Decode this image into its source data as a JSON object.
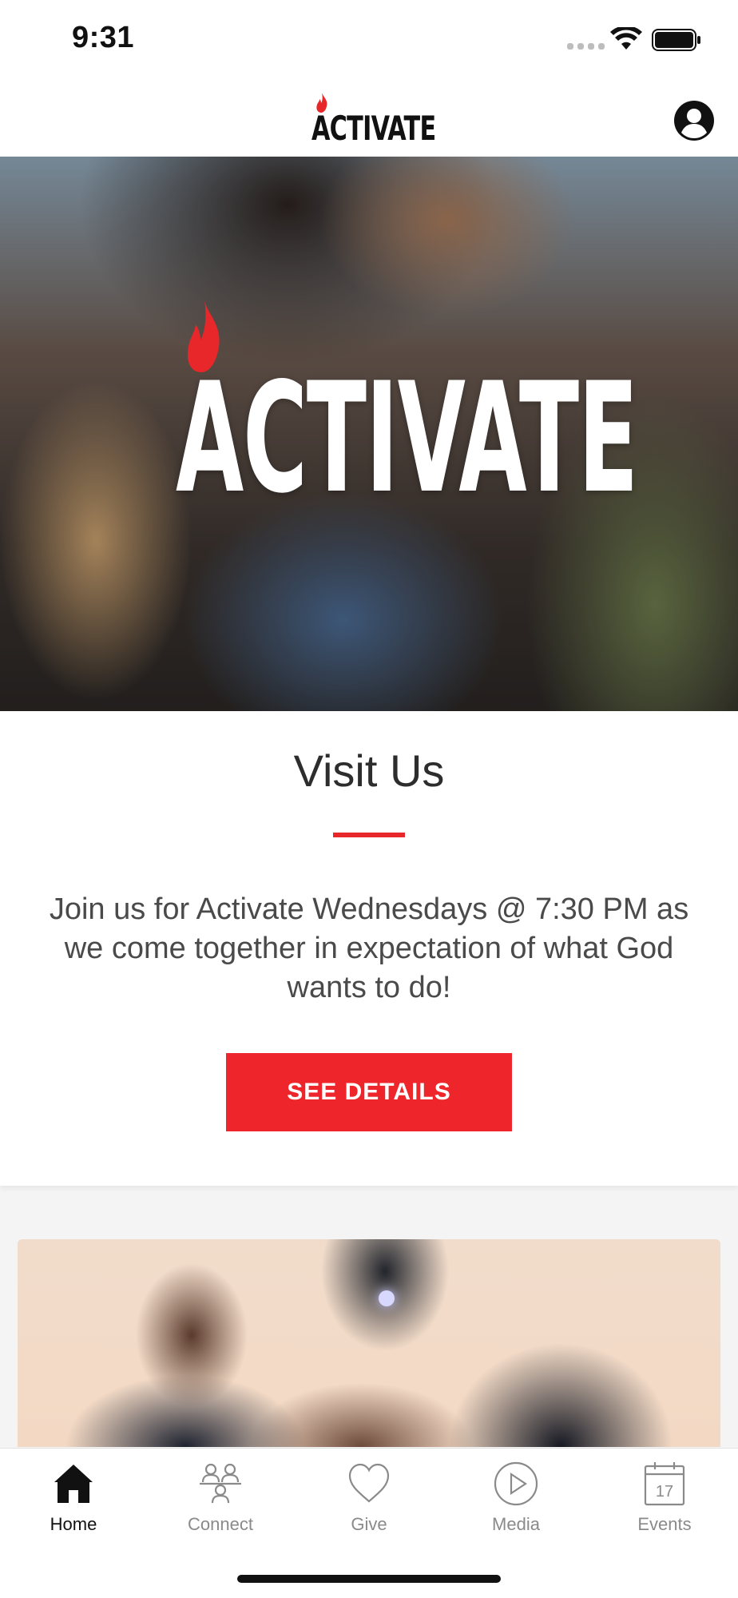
{
  "status_bar": {
    "time": "9:31"
  },
  "header": {
    "logo_text": "ACTIVATE",
    "profile_icon": "user-circle-icon"
  },
  "hero": {
    "title": "ACTIVATE",
    "flame_icon": "flame-icon"
  },
  "visit": {
    "title": "Visit Us",
    "description": "Join us for Activate Wednesdays @ 7:30 PM as we come together in expectation of what God wants to do!",
    "button_label": "SEE DETAILS"
  },
  "tabs": [
    {
      "label": "Home",
      "icon": "home-icon",
      "active": true
    },
    {
      "label": "Connect",
      "icon": "people-icon",
      "active": false
    },
    {
      "label": "Give",
      "icon": "heart-icon",
      "active": false
    },
    {
      "label": "Media",
      "icon": "play-icon",
      "active": false
    },
    {
      "label": "Events",
      "icon": "calendar-icon",
      "active": false
    }
  ],
  "colors": {
    "accent": "#ee262b",
    "tab_active": "#111111",
    "tab_inactive": "#8a8a8a"
  }
}
